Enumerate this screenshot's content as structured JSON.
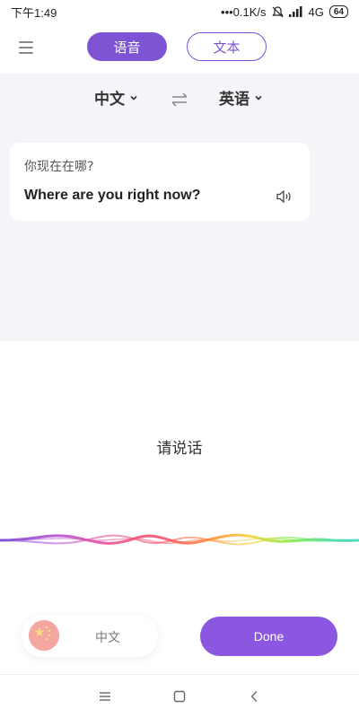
{
  "status_bar": {
    "time": "下午1:49",
    "network_speed": "•••0.1K/s",
    "network_type": "4G",
    "battery": "64",
    "icons": [
      "mute-icon",
      "signal-icon",
      "battery-icon"
    ]
  },
  "header": {
    "menu_icon": "menu-icon",
    "tabs": [
      {
        "label": "语音",
        "active": true
      },
      {
        "label": "文本",
        "active": false
      }
    ]
  },
  "languages": {
    "source": "中文",
    "target": "英语",
    "swap_icon": "swap-icon"
  },
  "translation": {
    "source_text": "你现在在哪?",
    "target_text": "Where are you right now?",
    "speaker_icon": "speaker-icon"
  },
  "prompt": "请说话",
  "bottom": {
    "current_language": "中文",
    "done_label": "Done"
  },
  "colors": {
    "accent": "#7e54d4",
    "done_button": "#8b57e0",
    "panel_bg": "#f5f4f8"
  }
}
